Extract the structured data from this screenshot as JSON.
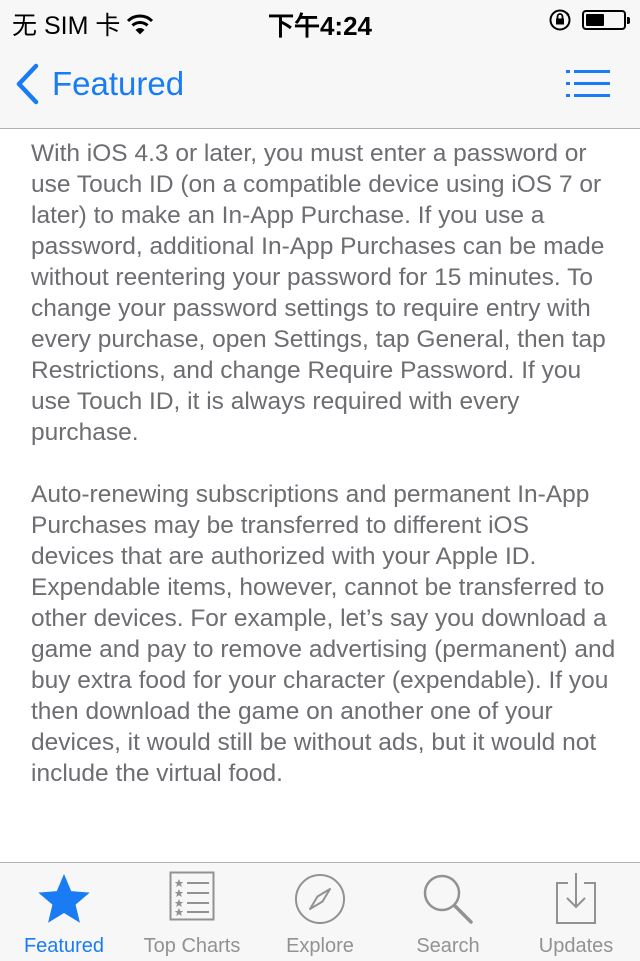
{
  "status_bar": {
    "carrier": "无 SIM 卡",
    "time": "下午4:24"
  },
  "nav": {
    "back_label": "Featured",
    "accent_color": "#1a7cf5"
  },
  "content": {
    "paragraph_1": "With iOS 4.3 or later, you must enter a password or use Touch ID (on a compatible device using iOS 7 or later) to make an In-App Purchase. If you use a password, additional In-App Purchases can be made without reentering your password for 15 minutes. To change your password settings to require entry with every purchase, open Settings, tap General, then tap Restrictions, and change Require Password. If you use Touch ID, it is always required with every purchase.",
    "paragraph_2": "Auto-renewing subscriptions and permanent In-App Purchases may be transferred to different iOS devices that are authorized with your Apple ID. Expendable items, however, cannot be transferred to other devices. For example, let’s say you download a game and pay to remove advertising (permanent) and buy extra food for your character (expendable). If you then download the game on another one of your devices, it would still be without ads, but it would not include the virtual food."
  },
  "tabbar": {
    "tabs": [
      {
        "label": "Featured",
        "icon": "star-icon",
        "active": true
      },
      {
        "label": "Top Charts",
        "icon": "list-icon",
        "active": false
      },
      {
        "label": "Explore",
        "icon": "compass-icon",
        "active": false
      },
      {
        "label": "Search",
        "icon": "search-icon",
        "active": false
      },
      {
        "label": "Updates",
        "icon": "download-tray-icon",
        "active": false
      }
    ]
  }
}
